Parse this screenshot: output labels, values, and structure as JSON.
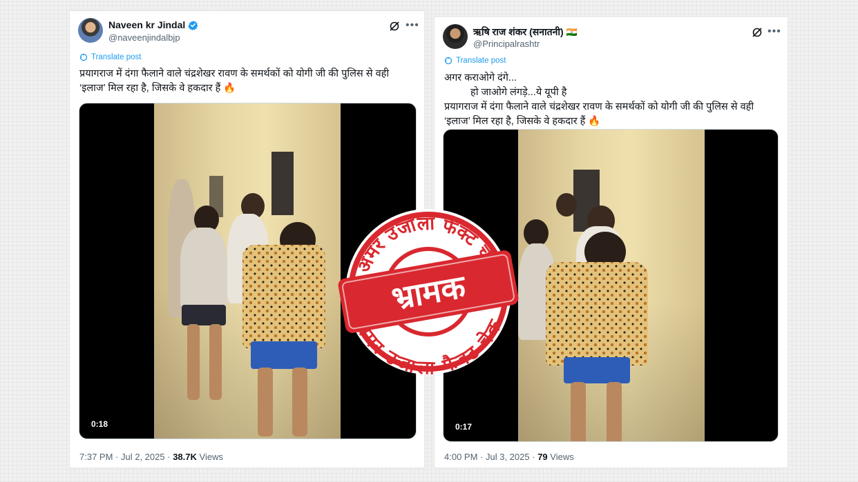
{
  "tweets": [
    {
      "display_name": "Naveen kr Jindal",
      "handle": "@naveenjindalbjp",
      "verified": true,
      "translate_label": "Translate post",
      "text_lines": [
        "प्रयागराज में दंगा फैलाने वाले चंद्रशेखर रावण के समर्थकों को योगी जी की पुलिस से वही",
        "‘इलाज’ मिल रहा है, जिसके वे हकदार हैं"
      ],
      "emoji": "🔥",
      "duration": "0:18",
      "time": "7:37 PM",
      "date": "Jul 2, 2025",
      "views_count": "38.7K",
      "views_label": "Views"
    },
    {
      "display_name": "ऋषि राज शंकर (सनातनी)",
      "handle": "@Principalrashtr",
      "flag": "🇮🇳",
      "translate_label": "Translate post",
      "intro_lines": [
        "अगर कराओगे दंगे...",
        "हो जाओगे लंगड़े...ये यूपी है"
      ],
      "text_lines": [
        "प्रयागराज में दंगा फैलाने वाले चंद्रशेखर रावण के समर्थकों को योगी जी की पुलिस से वही",
        "‘इलाज’ मिल रहा है, जिसके वे हकदार हैं"
      ],
      "emoji": "🔥",
      "duration": "0:17",
      "time": "4:00 PM",
      "date": "Jul 3, 2025",
      "views_count": "79",
      "views_label": "Views"
    }
  ],
  "stamp": {
    "label": "भ्रामक",
    "ring_text": "अमर उजाला फैक्ट चेक",
    "color": "#d9282f"
  },
  "colors": {
    "link": "#1d9bf0",
    "verified": "#1d9bf0",
    "text": "#0f1419",
    "muted": "#536471"
  }
}
